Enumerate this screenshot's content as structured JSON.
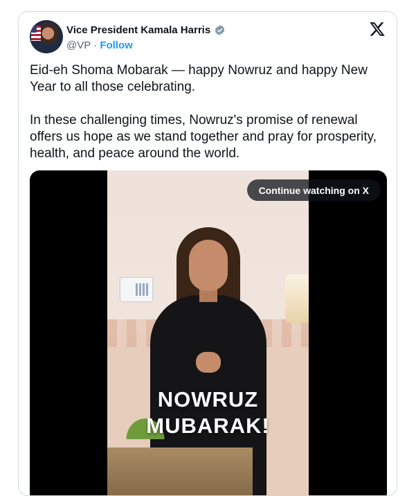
{
  "author": {
    "name": "Vice President Kamala Harris",
    "handle": "@VP",
    "separator": "·",
    "follow_label": "Follow"
  },
  "icons": {
    "verified": "verified-badge-icon",
    "platform": "x-logo-icon"
  },
  "colors": {
    "accent": "#1d9bf0",
    "text": "#0f1419",
    "muted": "#536471",
    "border": "#cfd9de"
  },
  "tweet": {
    "paragraphs": [
      "Eid-eh Shoma Mobarak — happy Nowruz and happy New Year to all those celebrating.",
      "In these challenging times, Nowruz's promise of renewal offers us hope as we stand together and pray for prosperity, health, and peace around the world."
    ]
  },
  "media": {
    "continue_label": "Continue watching on X",
    "overlay_line1": "NOWRUZ",
    "overlay_line2": "MUBARAK!"
  }
}
